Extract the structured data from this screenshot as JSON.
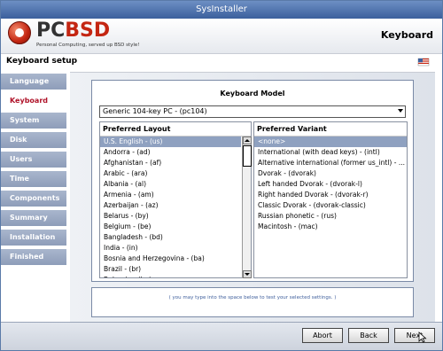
{
  "window": {
    "title": "SysInstaller"
  },
  "header": {
    "logo_part1": "PC",
    "logo_part2": "BSD",
    "tagline": "Personal Computing, served up BSD style!",
    "page_title": "Keyboard"
  },
  "subheader": {
    "title": "Keyboard setup",
    "flag_icon": "us-flag-icon"
  },
  "sidebar": {
    "items": [
      {
        "label": "Language",
        "active": false
      },
      {
        "label": "Keyboard",
        "active": true
      },
      {
        "label": "System",
        "active": false
      },
      {
        "label": "Disk",
        "active": false
      },
      {
        "label": "Users",
        "active": false
      },
      {
        "label": "Time",
        "active": false
      },
      {
        "label": "Components",
        "active": false
      },
      {
        "label": "Summary",
        "active": false
      },
      {
        "label": "Installation",
        "active": false
      },
      {
        "label": "Finished",
        "active": false
      }
    ]
  },
  "keyboard_model": {
    "label": "Keyboard Model",
    "selected": "Generic 104-key PC - (pc104)"
  },
  "layout": {
    "header": "Preferred Layout",
    "items": [
      "U.S. English - (us)",
      "Andorra - (ad)",
      "Afghanistan - (af)",
      "Arabic - (ara)",
      "Albania - (al)",
      "Armenia - (am)",
      "Azerbaijan - (az)",
      "Belarus - (by)",
      "Belgium - (be)",
      "Bangladesh - (bd)",
      "India - (in)",
      "Bosnia and Herzegovina - (ba)",
      "Brazil - (br)",
      "Bulgaria - (bg)"
    ],
    "selected_index": 0
  },
  "variant": {
    "header": "Preferred Variant",
    "items": [
      "<none>",
      "International (with dead keys) - (intl)",
      "Alternative international (former us_intl) - ...",
      "Dvorak - (dvorak)",
      "Left handed Dvorak - (dvorak-l)",
      "Right handed Dvorak - (dvorak-r)",
      "Classic Dvorak - (dvorak-classic)",
      "Russian phonetic - (rus)",
      "Macintosh - (mac)"
    ],
    "selected_index": 0
  },
  "test_area": {
    "hint": "( you may type into the space below to test your selected settings. )"
  },
  "footer": {
    "abort": "Abort",
    "back": "Back",
    "next": "Next"
  },
  "colors": {
    "titlebar": "#3b5f9c",
    "active_nav": "#b0142a",
    "selection": "#8fa1c0"
  }
}
